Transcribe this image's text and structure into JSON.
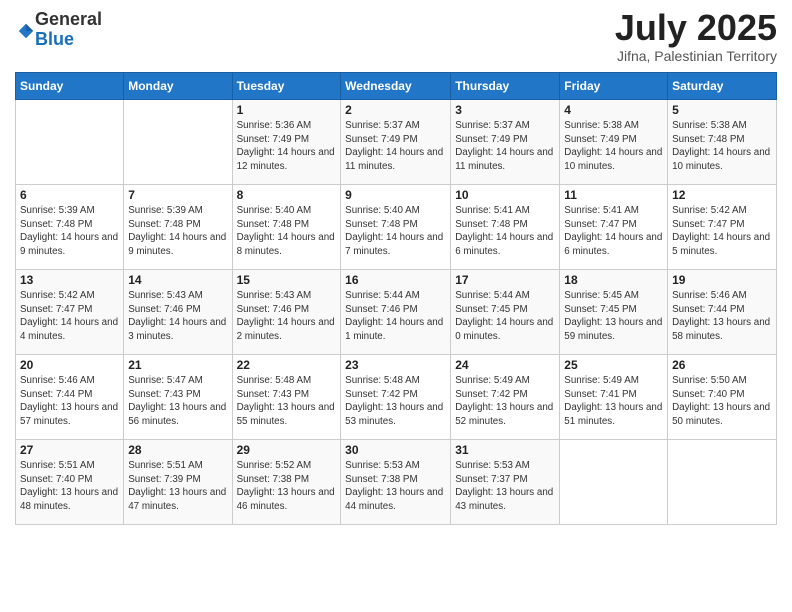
{
  "logo": {
    "general": "General",
    "blue": "Blue"
  },
  "header": {
    "month": "July 2025",
    "location": "Jifna, Palestinian Territory"
  },
  "weekdays": [
    "Sunday",
    "Monday",
    "Tuesday",
    "Wednesday",
    "Thursday",
    "Friday",
    "Saturday"
  ],
  "weeks": [
    [
      {
        "day": "",
        "info": ""
      },
      {
        "day": "",
        "info": ""
      },
      {
        "day": "1",
        "info": "Sunrise: 5:36 AM\nSunset: 7:49 PM\nDaylight: 14 hours and 12 minutes."
      },
      {
        "day": "2",
        "info": "Sunrise: 5:37 AM\nSunset: 7:49 PM\nDaylight: 14 hours and 11 minutes."
      },
      {
        "day": "3",
        "info": "Sunrise: 5:37 AM\nSunset: 7:49 PM\nDaylight: 14 hours and 11 minutes."
      },
      {
        "day": "4",
        "info": "Sunrise: 5:38 AM\nSunset: 7:49 PM\nDaylight: 14 hours and 10 minutes."
      },
      {
        "day": "5",
        "info": "Sunrise: 5:38 AM\nSunset: 7:48 PM\nDaylight: 14 hours and 10 minutes."
      }
    ],
    [
      {
        "day": "6",
        "info": "Sunrise: 5:39 AM\nSunset: 7:48 PM\nDaylight: 14 hours and 9 minutes."
      },
      {
        "day": "7",
        "info": "Sunrise: 5:39 AM\nSunset: 7:48 PM\nDaylight: 14 hours and 9 minutes."
      },
      {
        "day": "8",
        "info": "Sunrise: 5:40 AM\nSunset: 7:48 PM\nDaylight: 14 hours and 8 minutes."
      },
      {
        "day": "9",
        "info": "Sunrise: 5:40 AM\nSunset: 7:48 PM\nDaylight: 14 hours and 7 minutes."
      },
      {
        "day": "10",
        "info": "Sunrise: 5:41 AM\nSunset: 7:48 PM\nDaylight: 14 hours and 6 minutes."
      },
      {
        "day": "11",
        "info": "Sunrise: 5:41 AM\nSunset: 7:47 PM\nDaylight: 14 hours and 6 minutes."
      },
      {
        "day": "12",
        "info": "Sunrise: 5:42 AM\nSunset: 7:47 PM\nDaylight: 14 hours and 5 minutes."
      }
    ],
    [
      {
        "day": "13",
        "info": "Sunrise: 5:42 AM\nSunset: 7:47 PM\nDaylight: 14 hours and 4 minutes."
      },
      {
        "day": "14",
        "info": "Sunrise: 5:43 AM\nSunset: 7:46 PM\nDaylight: 14 hours and 3 minutes."
      },
      {
        "day": "15",
        "info": "Sunrise: 5:43 AM\nSunset: 7:46 PM\nDaylight: 14 hours and 2 minutes."
      },
      {
        "day": "16",
        "info": "Sunrise: 5:44 AM\nSunset: 7:46 PM\nDaylight: 14 hours and 1 minute."
      },
      {
        "day": "17",
        "info": "Sunrise: 5:44 AM\nSunset: 7:45 PM\nDaylight: 14 hours and 0 minutes."
      },
      {
        "day": "18",
        "info": "Sunrise: 5:45 AM\nSunset: 7:45 PM\nDaylight: 13 hours and 59 minutes."
      },
      {
        "day": "19",
        "info": "Sunrise: 5:46 AM\nSunset: 7:44 PM\nDaylight: 13 hours and 58 minutes."
      }
    ],
    [
      {
        "day": "20",
        "info": "Sunrise: 5:46 AM\nSunset: 7:44 PM\nDaylight: 13 hours and 57 minutes."
      },
      {
        "day": "21",
        "info": "Sunrise: 5:47 AM\nSunset: 7:43 PM\nDaylight: 13 hours and 56 minutes."
      },
      {
        "day": "22",
        "info": "Sunrise: 5:48 AM\nSunset: 7:43 PM\nDaylight: 13 hours and 55 minutes."
      },
      {
        "day": "23",
        "info": "Sunrise: 5:48 AM\nSunset: 7:42 PM\nDaylight: 13 hours and 53 minutes."
      },
      {
        "day": "24",
        "info": "Sunrise: 5:49 AM\nSunset: 7:42 PM\nDaylight: 13 hours and 52 minutes."
      },
      {
        "day": "25",
        "info": "Sunrise: 5:49 AM\nSunset: 7:41 PM\nDaylight: 13 hours and 51 minutes."
      },
      {
        "day": "26",
        "info": "Sunrise: 5:50 AM\nSunset: 7:40 PM\nDaylight: 13 hours and 50 minutes."
      }
    ],
    [
      {
        "day": "27",
        "info": "Sunrise: 5:51 AM\nSunset: 7:40 PM\nDaylight: 13 hours and 48 minutes."
      },
      {
        "day": "28",
        "info": "Sunrise: 5:51 AM\nSunset: 7:39 PM\nDaylight: 13 hours and 47 minutes."
      },
      {
        "day": "29",
        "info": "Sunrise: 5:52 AM\nSunset: 7:38 PM\nDaylight: 13 hours and 46 minutes."
      },
      {
        "day": "30",
        "info": "Sunrise: 5:53 AM\nSunset: 7:38 PM\nDaylight: 13 hours and 44 minutes."
      },
      {
        "day": "31",
        "info": "Sunrise: 5:53 AM\nSunset: 7:37 PM\nDaylight: 13 hours and 43 minutes."
      },
      {
        "day": "",
        "info": ""
      },
      {
        "day": "",
        "info": ""
      }
    ]
  ]
}
